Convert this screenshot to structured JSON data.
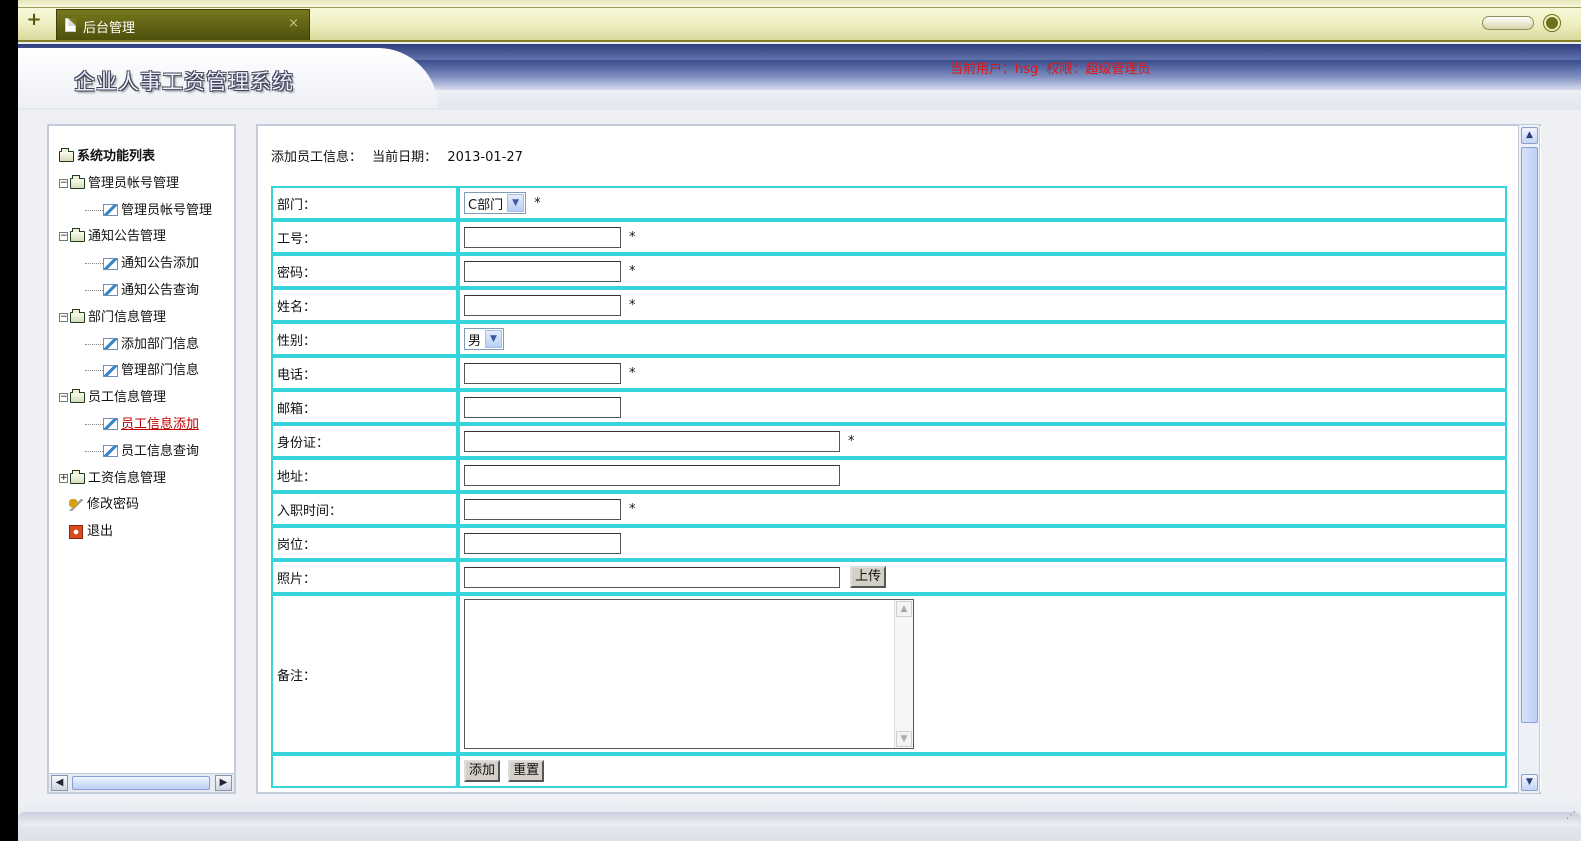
{
  "tabbar": {
    "tab_title": "后台管理",
    "close_label": "×"
  },
  "header": {
    "system_title": "企业人事工资管理系统",
    "user_label": "当前用户：hsg",
    "role_label": "权限：超级管理员"
  },
  "sidebar": {
    "root": "系统功能列表",
    "groups": [
      {
        "label": "管理员帐号管理",
        "items": [
          "管理员帐号管理"
        ]
      },
      {
        "label": "通知公告管理",
        "items": [
          "通知公告添加",
          "通知公告查询"
        ]
      },
      {
        "label": "部门信息管理",
        "items": [
          "添加部门信息",
          "管理部门信息"
        ]
      },
      {
        "label": "员工信息管理",
        "items": [
          "员工信息添加",
          "员工信息查询"
        ]
      },
      {
        "label": "工资信息管理",
        "items": []
      }
    ],
    "change_password": "修改密码",
    "logout": "退出"
  },
  "form": {
    "heading": "添加员工信息：",
    "date_label": "当前日期：",
    "date_value": "2013-01-27",
    "required_mark": "*",
    "fields": {
      "department": {
        "label": "部门：",
        "value": "C部门"
      },
      "emp_no": {
        "label": "工号："
      },
      "password": {
        "label": "密码："
      },
      "name": {
        "label": "姓名："
      },
      "gender": {
        "label": "性别：",
        "value": "男"
      },
      "phone": {
        "label": "电话："
      },
      "email": {
        "label": "邮箱："
      },
      "id_card": {
        "label": "身份证："
      },
      "address": {
        "label": "地址："
      },
      "hire_date": {
        "label": "入职时间："
      },
      "position": {
        "label": "岗位："
      },
      "photo": {
        "label": "照片：",
        "upload_label": "上传"
      },
      "remarks": {
        "label": "备注："
      }
    },
    "add_label": "添加",
    "reset_label": "重置"
  },
  "colors": {
    "accent_red": "#e01515",
    "table_border": "#36d4dc",
    "tab_olive": "#5e5f12"
  }
}
